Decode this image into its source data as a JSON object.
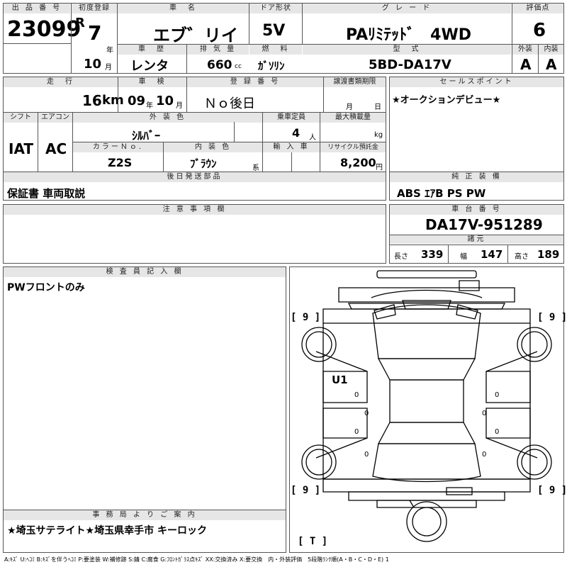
{
  "header": {
    "lot_no_label": "出 品 番 号",
    "lot_no": "23099",
    "first_reg_label": "初度登録",
    "era": "R",
    "year": "7",
    "year_unit": "年",
    "month": "10",
    "month_unit": "月",
    "car_name_label": "車　名",
    "car_name": "エブ゛リイ",
    "door_label": "ドア形状",
    "door": "5V",
    "grade_label": "グ レ ー ド",
    "grade": "PAﾘﾐﾃｯﾄﾞ　4WD",
    "score_label": "評価点",
    "score": "6",
    "history_label": "車　歴",
    "history": "レンタ",
    "displacement_label": "排 気 量",
    "displacement": "660",
    "displacement_unit": "cc",
    "fuel_label": "燃　料",
    "fuel": "ｶﾞｿﾘﾝ",
    "model_label": "型　式",
    "model": "5BD-DA17V",
    "ext_label": "外装",
    "ext": "A",
    "int_label": "内装",
    "int": "A"
  },
  "row2": {
    "mileage_label": "走　行",
    "mileage": "16",
    "mileage_unit": "km",
    "inspection_label": "車　検",
    "insp_year": "09",
    "insp_year_unit": "年",
    "insp_month": "10",
    "insp_month_unit": "月",
    "plate_label": "登 録 番 号",
    "plate": "Ｎｏ後日",
    "transfer_label": "譲渡書類期限",
    "transfer_month": "月",
    "transfer_day": "日",
    "shift_label": "シフト",
    "shift": "IAT",
    "ac_label": "エアコン",
    "ac": "AC",
    "color_label": "外 装 色",
    "color": "ｼﾙﾊﾞｰ",
    "capacity_label": "乗車定員",
    "capacity": "4",
    "capacity_unit": "人",
    "load_label": "最大積載量",
    "load_unit": "kg",
    "color_no_label": "カラーＮｏ.",
    "color_no": "Z2S",
    "interior_color_label": "内 装 色",
    "interior_color": "ﾌﾞﾗｳﾝ",
    "interior_suffix": "系",
    "import_label": "輸 入 車",
    "recycle_label": "リサイクル預託金",
    "recycle": "8,200",
    "recycle_unit": "円"
  },
  "sales": {
    "label": "セールスポイント",
    "text": "★オークションデビュー★"
  },
  "later_parts": {
    "label": "後日発送部品",
    "text": "保証書 車両取説"
  },
  "equipment": {
    "label": "純 正 装 備",
    "text": "ABS ｴｱB PS PW"
  },
  "notes": {
    "label": "注 意 事 項 欄",
    "text": ""
  },
  "chassis": {
    "label": "車 台 番 号",
    "number": "DA17V-951289",
    "spec_label": "諸元",
    "length_label": "長さ",
    "length": "339",
    "width_label": "幅",
    "width": "147",
    "height_label": "高さ",
    "height": "189"
  },
  "inspector": {
    "label": "検 査 員 記 入 欄",
    "text": "PWフロントのみ"
  },
  "office": {
    "label": "事 務 局 よ り ご 案 内",
    "text": "★埼玉サテライト★埼玉県幸手市 キーロック"
  },
  "diagram": {
    "tire_fl": "[ 9 ]",
    "tire_fr": "[ 9 ]",
    "tire_rl": "[ 9 ]",
    "tire_rr": "[ 9 ]",
    "spare": "[ T ]",
    "mark": "U1",
    "zeros": [
      "0",
      "0",
      "0",
      "0",
      "0",
      "0",
      "0",
      "0"
    ]
  },
  "legend": "A:ｷｽﾞ U:ﾍｺﾐ B:ｷｽﾞを伴うﾍｺﾐ P:要塗装 W:補修跡 S:錆 C:腐食 G:ﾌﾛﾝﾄｶﾞﾗｽ点ｷｽﾞ XX:交換済み X:要交換　内・外装評価　5段階ﾗﾝｸ順(A・B・C・D・E) 1"
}
